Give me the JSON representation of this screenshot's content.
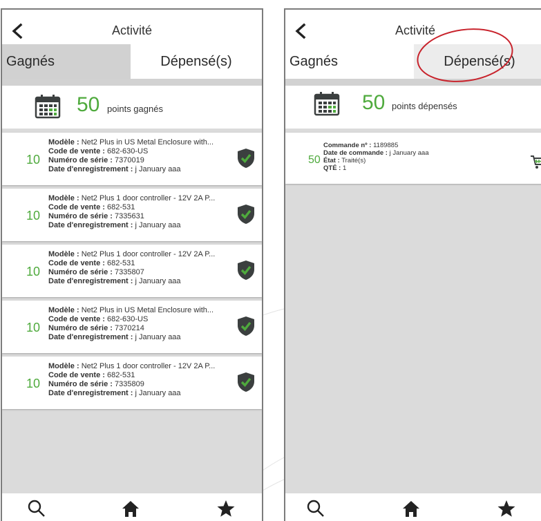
{
  "colors": {
    "accent_green": "#4faa3d",
    "shield_dark": "#3b3f3f",
    "annotation_red": "#c8232c",
    "background": "#dbdbdb"
  },
  "left_screen": {
    "header": {
      "title": "Activité"
    },
    "tabs": [
      {
        "label": "Gagnés"
      },
      {
        "label": "Dépensé(s)"
      }
    ],
    "summary": {
      "value": "50",
      "label": "points gagnés"
    },
    "items": [
      {
        "points": "10",
        "model_label": "Modèle :",
        "model_value": "Net2 Plus in US Metal Enclosure with...",
        "sale_code_label": "Code de vente :",
        "sale_code_value": "682-630-US",
        "serial_label": "Numéro de série :",
        "serial_value": "7370019",
        "date_label": "Date d'enregistrement :",
        "date_value": "j January aaa"
      },
      {
        "points": "10",
        "model_label": "Modèle :",
        "model_value": "Net2 Plus 1 door controller - 12V 2A P...",
        "sale_code_label": "Code de vente :",
        "sale_code_value": "682-531",
        "serial_label": "Numéro de série :",
        "serial_value": "7335631",
        "date_label": "Date d'enregistrement :",
        "date_value": "j January aaa"
      },
      {
        "points": "10",
        "model_label": "Modèle :",
        "model_value": "Net2 Plus 1 door controller - 12V 2A P...",
        "sale_code_label": "Code de vente :",
        "sale_code_value": "682-531",
        "serial_label": "Numéro de série :",
        "serial_value": "7335807",
        "date_label": "Date d'enregistrement :",
        "date_value": "j January aaa"
      },
      {
        "points": "10",
        "model_label": "Modèle :",
        "model_value": "Net2 Plus in US Metal Enclosure with...",
        "sale_code_label": "Code de vente :",
        "sale_code_value": "682-630-US",
        "serial_label": "Numéro de série :",
        "serial_value": "7370214",
        "date_label": "Date d'enregistrement :",
        "date_value": "j January aaa"
      },
      {
        "points": "10",
        "model_label": "Modèle :",
        "model_value": "Net2 Plus 1 door controller - 12V 2A P...",
        "sale_code_label": "Code de vente :",
        "sale_code_value": "682-531",
        "serial_label": "Numéro de série :",
        "serial_value": "7335809",
        "date_label": "Date d'enregistrement :",
        "date_value": "j January aaa"
      }
    ],
    "bottom_nav": [
      {
        "icon": "search-icon"
      },
      {
        "icon": "home-icon"
      },
      {
        "icon": "star-icon"
      }
    ]
  },
  "right_screen": {
    "header": {
      "title": "Activité"
    },
    "tabs": [
      {
        "label": "Gagnés"
      },
      {
        "label": "Dépensé(s)"
      }
    ],
    "summary": {
      "value": "50",
      "label": "points dépensés"
    },
    "order": {
      "points": "50",
      "order_label": "Commande nº :",
      "order_value": "1189885",
      "date_label": "Date de commande :",
      "date_value": "j January aaa",
      "status_label": "État :",
      "status_value": "Traité(s)",
      "qty_label": "QTÉ :",
      "qty_value": "1"
    },
    "bottom_nav": [
      {
        "icon": "search-icon"
      },
      {
        "icon": "home-icon"
      },
      {
        "icon": "star-icon"
      }
    ]
  }
}
